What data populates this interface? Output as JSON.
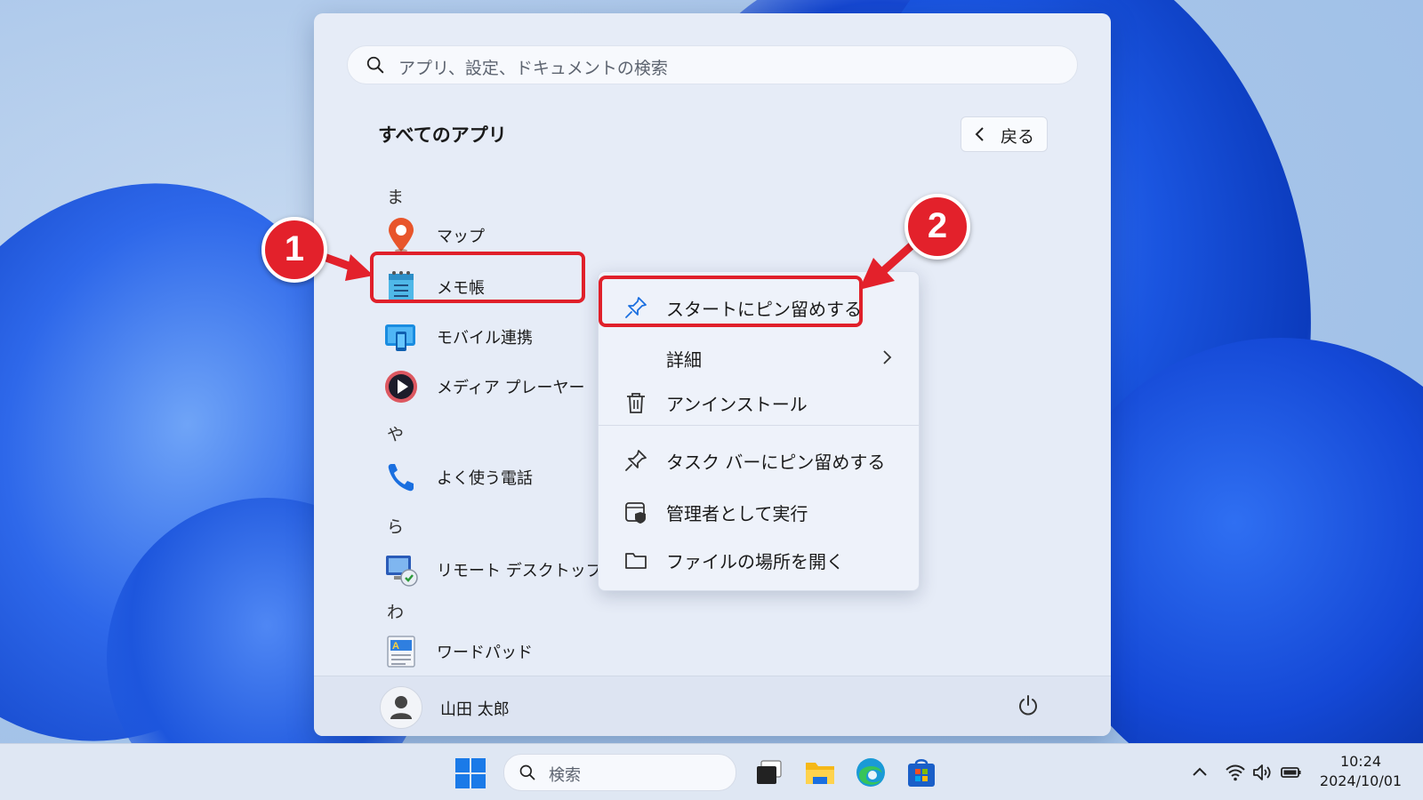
{
  "start_menu": {
    "search_placeholder": "アプリ、設定、ドキュメントの検索",
    "section_title": "すべてのアプリ",
    "back_label": "戻る",
    "groups": [
      {
        "letter": "ま",
        "apps": [
          "マップ",
          "メモ帳",
          "モバイル連携",
          "メディア プレーヤー"
        ]
      },
      {
        "letter": "や",
        "apps": [
          "よく使う電話"
        ]
      },
      {
        "letter": "ら",
        "apps": [
          "リモート デスクトップ接続"
        ]
      },
      {
        "letter": "わ",
        "apps": [
          "ワードパッド"
        ]
      }
    ],
    "user_name": "山田 太郎"
  },
  "context_menu": {
    "items": [
      {
        "label": "スタートにピン留めする",
        "icon": "pin-icon"
      },
      {
        "label": "詳細",
        "icon": "none",
        "submenu": true
      },
      {
        "label": "アンインストール",
        "icon": "trash-icon"
      },
      {
        "label": "タスク バーにピン留めする",
        "icon": "pin-icon"
      },
      {
        "label": "管理者として実行",
        "icon": "admin-shield-icon"
      },
      {
        "label": "ファイルの場所を開く",
        "icon": "folder-icon"
      }
    ]
  },
  "callouts": {
    "one": "1",
    "two": "2"
  },
  "taskbar": {
    "search_label": "検索",
    "time": "10:24",
    "date": "2024/10/01"
  },
  "colors": {
    "highlight": "#e0202a",
    "accent": "#1a6fe0"
  }
}
